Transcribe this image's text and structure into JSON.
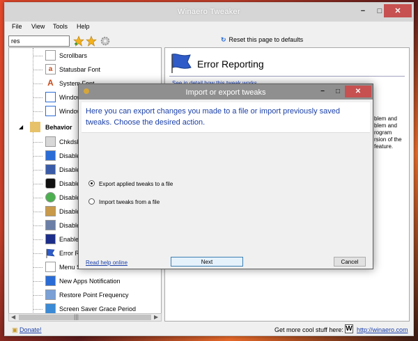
{
  "window": {
    "title": "Winaero Tweaker"
  },
  "menu": [
    "File",
    "View",
    "Tools",
    "Help"
  ],
  "toolbar": {
    "search_value": "res",
    "reset_label": "Reset this page to defaults"
  },
  "tree": {
    "items_top": [
      "Scrollbars",
      "Statusbar Font",
      "System Font",
      "Window B",
      "Window T"
    ],
    "category": "Behavior",
    "items_behavior": [
      "Chkdsk Ti",
      "Disable A",
      "Disable A",
      "Disable A",
      "Disable A",
      "Disable De",
      "Disable M",
      "Enable Cr",
      "Error Repo",
      "Menu Sho",
      "New Apps Notification",
      "Restore Point Frequency",
      "Screen Saver Grace Period"
    ]
  },
  "right_panel": {
    "heading": "Error Reporting",
    "detail_link": "See in detail how this tweak works",
    "partial_desc": [
      "blem and",
      "blem and",
      "rogram",
      "rsion of the",
      "feature."
    ]
  },
  "statusbar": {
    "donate": "Donate!",
    "get_more": "Get more cool stuff here:",
    "logo_letter": "W",
    "url": "http://winaero.com"
  },
  "dialog": {
    "title": "Import or export tweaks",
    "message": "Here you can export changes you made to a file or import previously saved tweaks. Choose the desired action.",
    "options": [
      {
        "label": "Export applied tweaks to a file",
        "checked": true
      },
      {
        "label": "Import tweaks from a file",
        "checked": false
      }
    ],
    "help_link": "Read help online",
    "next_label": "Next",
    "cancel_label": "Cancel"
  },
  "colors": {
    "accent": "#1a3fa8",
    "close_red": "#c75050"
  }
}
